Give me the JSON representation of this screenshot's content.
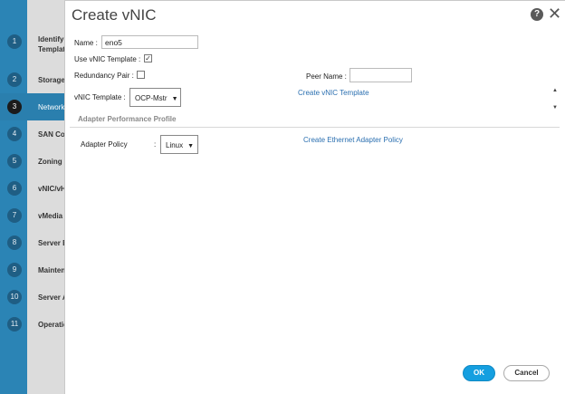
{
  "wizard": {
    "steps": [
      {
        "num": "1",
        "label": "Identify Templat",
        "active": false
      },
      {
        "num": "2",
        "label": "Storage",
        "active": false
      },
      {
        "num": "3",
        "label": "Network",
        "active": true
      },
      {
        "num": "4",
        "label": "SAN Co",
        "active": false
      },
      {
        "num": "5",
        "label": "Zoning",
        "active": false
      },
      {
        "num": "6",
        "label": "vNIC/vH",
        "active": false
      },
      {
        "num": "7",
        "label": "vMedia",
        "active": false
      },
      {
        "num": "8",
        "label": "Server B",
        "active": false
      },
      {
        "num": "9",
        "label": "Mainten",
        "active": false
      },
      {
        "num": "10",
        "label": "Server A",
        "active": false
      },
      {
        "num": "11",
        "label": "Operatio",
        "active": false
      }
    ]
  },
  "dialog": {
    "title": "Create vNIC",
    "help_glyph": "?",
    "close_glyph": "✕",
    "name_label": "Name :",
    "name_value": "eno5",
    "use_template_label": "Use vNIC Template :",
    "use_template_checked": true,
    "redundancy_label": "Redundancy Pair :",
    "redundancy_checked": false,
    "peer_name_label": "Peer Name :",
    "peer_name_value": "",
    "template_label": "vNIC Template :",
    "template_value": "OCP-Mstr",
    "create_template_link": "Create vNIC Template",
    "section_title": "Adapter Performance Profile",
    "adapter_policy_label": "Adapter Policy",
    "adapter_policy_colon": ":",
    "adapter_policy_value": "Linux",
    "create_adapter_policy_link": "Create Ethernet Adapter Policy",
    "ok_label": "OK",
    "cancel_label": "Cancel"
  }
}
